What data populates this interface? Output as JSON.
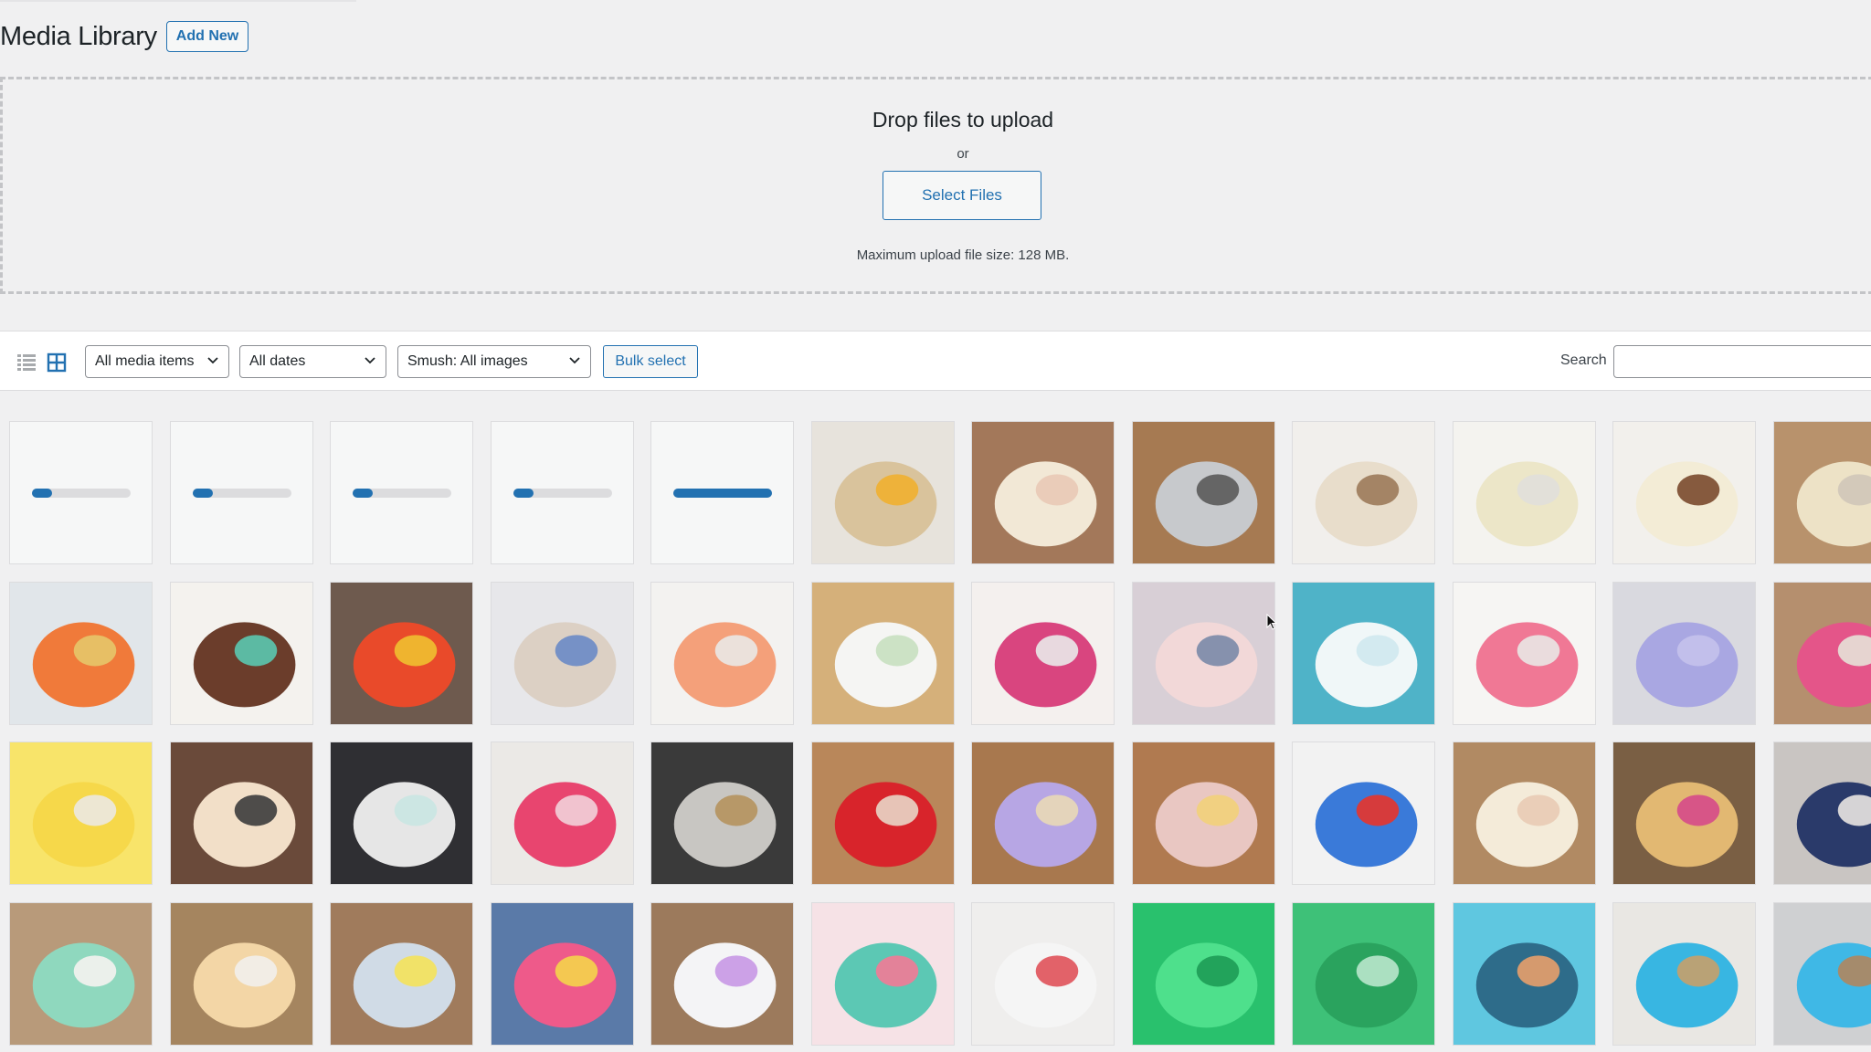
{
  "header": {
    "title": "Media Library",
    "add_new": "Add New"
  },
  "uploader": {
    "title": "Drop files to upload",
    "or": "or",
    "button": "Select Files",
    "max_size": "Maximum upload file size: 128 MB."
  },
  "toolbar": {
    "list_view_icon": "list-view-icon",
    "grid_view_icon": "grid-view-icon",
    "type_filter": "All media items",
    "date_filter": "All dates",
    "smush_filter": "Smush: All images",
    "bulk_select": "Bulk select",
    "search_label": "Search"
  },
  "uploads": [
    {
      "progress": 0.2
    },
    {
      "progress": 0.2
    },
    {
      "progress": 0.2
    },
    {
      "progress": 0.2
    },
    {
      "progress": 1.0
    }
  ],
  "media": [
    {
      "name": "eggs-in-bowl",
      "colors": [
        "#e7e3dc",
        "#d9c39c",
        "#f0b030"
      ]
    },
    {
      "name": "piping-bag-hands",
      "colors": [
        "#a3785a",
        "#f2e8d6",
        "#e9c9b6"
      ]
    },
    {
      "name": "cake-pans",
      "colors": [
        "#a67a52",
        "#c7c9cc",
        "#5a5a5a"
      ]
    },
    {
      "name": "cinnamon-roll-cake",
      "colors": [
        "#f1efec",
        "#e8ddcb",
        "#9c7a5a"
      ]
    },
    {
      "name": "drip-cake-white",
      "colors": [
        "#f4f3ef",
        "#ece6c8",
        "#e1dfda"
      ]
    },
    {
      "name": "frosting-spread",
      "colors": [
        "#f2f0ec",
        "#f3ecd6",
        "#7a4a2e"
      ]
    },
    {
      "name": "bowl-partial",
      "colors": [
        "#b8926c",
        "#ede2c6",
        "#cfc7b8"
      ]
    },
    {
      "name": "container-candy",
      "colors": [
        "#e1e6ea",
        "#f07a3a",
        "#e6c66a"
      ]
    },
    {
      "name": "rainbow-layer-cake",
      "colors": [
        "#f4f2ee",
        "#6b3d2b",
        "#5bc8b0"
      ]
    },
    {
      "name": "ombre-red-cake",
      "colors": [
        "#6e5a4e",
        "#e94a2a",
        "#f0c030"
      ]
    },
    {
      "name": "sprinkle-shake",
      "colors": [
        "#e7e7ea",
        "#dcd0c4",
        "#6a8ac6"
      ]
    },
    {
      "name": "peach-cake",
      "colors": [
        "#f3f2f0",
        "#f4a07a",
        "#eae8e5"
      ]
    },
    {
      "name": "white-cake-spatula",
      "colors": [
        "#d5b07a",
        "#f5f5f3",
        "#c8e0c0"
      ]
    },
    {
      "name": "pink-cake",
      "colors": [
        "#f4f0ee",
        "#d9457f",
        "#e9e9ea"
      ]
    },
    {
      "name": "heart-cookie",
      "colors": [
        "#d8cfd6",
        "#f2d8d8",
        "#7a8aa8"
      ]
    },
    {
      "name": "blue-piping",
      "colors": [
        "#4fb3c8",
        "#f0f7f8",
        "#cfe8ee"
      ]
    },
    {
      "name": "pink-frosting-bowl",
      "colors": [
        "#f6f5f3",
        "#f07895",
        "#e9e7e4"
      ]
    },
    {
      "name": "purple-frosting",
      "colors": [
        "#d9d9df",
        "#a9a7e2",
        "#c4c2ec"
      ]
    },
    {
      "name": "gnome-partial",
      "colors": [
        "#b58f6e",
        "#e45589",
        "#e6e2d8"
      ]
    },
    {
      "name": "yellow-cake",
      "colors": [
        "#f8e46a",
        "#f6d84a",
        "#ece9e2"
      ]
    },
    {
      "name": "heart-cookies-rack",
      "colors": [
        "#6a4a3a",
        "#f2dfc8",
        "#3c3c3c"
      ]
    },
    {
      "name": "sink-washing",
      "colors": [
        "#2f2f33",
        "#e6e6e6",
        "#c9e5e2"
      ]
    },
    {
      "name": "flower-cookies",
      "colors": [
        "#ebe9e6",
        "#e8456f",
        "#f2d0d9"
      ]
    },
    {
      "name": "fridge-tray",
      "colors": [
        "#3a3a3a",
        "#c8c6c2",
        "#b5925e"
      ]
    },
    {
      "name": "red-frosting-bag",
      "colors": [
        "#b9875a",
        "#d8242b",
        "#e9d6c6"
      ]
    },
    {
      "name": "purple-kisses",
      "colors": [
        "#a8784e",
        "#b7a6e4",
        "#e9d9b6"
      ]
    },
    {
      "name": "sundae-glass",
      "colors": [
        "#b07a50",
        "#e9c7c2",
        "#f2d07a"
      ]
    },
    {
      "name": "rainbow-bubble-wrap",
      "colors": [
        "#f2f2f2",
        "#3a7ad9",
        "#e8342a"
      ]
    },
    {
      "name": "heart-cookie-hand",
      "colors": [
        "#b18a63",
        "#f4ebd9",
        "#e9cbb4"
      ]
    },
    {
      "name": "heart-cookies-mat",
      "colors": [
        "#7a5f44",
        "#e2b872",
        "#d64a8a"
      ]
    },
    {
      "name": "cake-jar-partial",
      "colors": [
        "#c9c5c2",
        "#2a3a6a",
        "#e9e6e2"
      ]
    },
    {
      "name": "mint-cake-paper",
      "colors": [
        "#b89a7a",
        "#8fd8be",
        "#f5f3f0"
      ]
    },
    {
      "name": "funfetti-layers",
      "colors": [
        "#a5855f",
        "#f3d6a6",
        "#f2f0ec"
      ]
    },
    {
      "name": "piping-bags-bag",
      "colors": [
        "#a07b5c",
        "#d0dbe6",
        "#f4e25a"
      ]
    },
    {
      "name": "rainbow-ruffle-cake",
      "colors": [
        "#5a7aa8",
        "#ee5a8a",
        "#f4d44a"
      ]
    },
    {
      "name": "purple-bag-bowl",
      "colors": [
        "#9c7a5c",
        "#f4f4f6",
        "#c898e6"
      ]
    },
    {
      "name": "teal-flower-cake",
      "colors": [
        "#f6e2e6",
        "#5cc8b4",
        "#f27a96"
      ]
    },
    {
      "name": "spatula-plate",
      "colors": [
        "#efeeed",
        "#f5f5f5",
        "#e0525a"
      ]
    },
    {
      "name": "green-fondant-a",
      "colors": [
        "#29c16d",
        "#4ee08c",
        "#1e9c55"
      ]
    },
    {
      "name": "green-fondant-b",
      "colors": [
        "#3ec178",
        "#2aa35e",
        "#b9e7cc"
      ]
    },
    {
      "name": "ice-cream-cake",
      "colors": [
        "#5fc7e0",
        "#2e6c8a",
        "#e8a06a"
      ]
    },
    {
      "name": "blue-cake-fondant",
      "colors": [
        "#e9e7e3",
        "#38b6e2",
        "#c8a06a"
      ]
    },
    {
      "name": "blue-cake-partial",
      "colors": [
        "#cfd0d2",
        "#3fb8e6",
        "#b0865e"
      ]
    }
  ]
}
